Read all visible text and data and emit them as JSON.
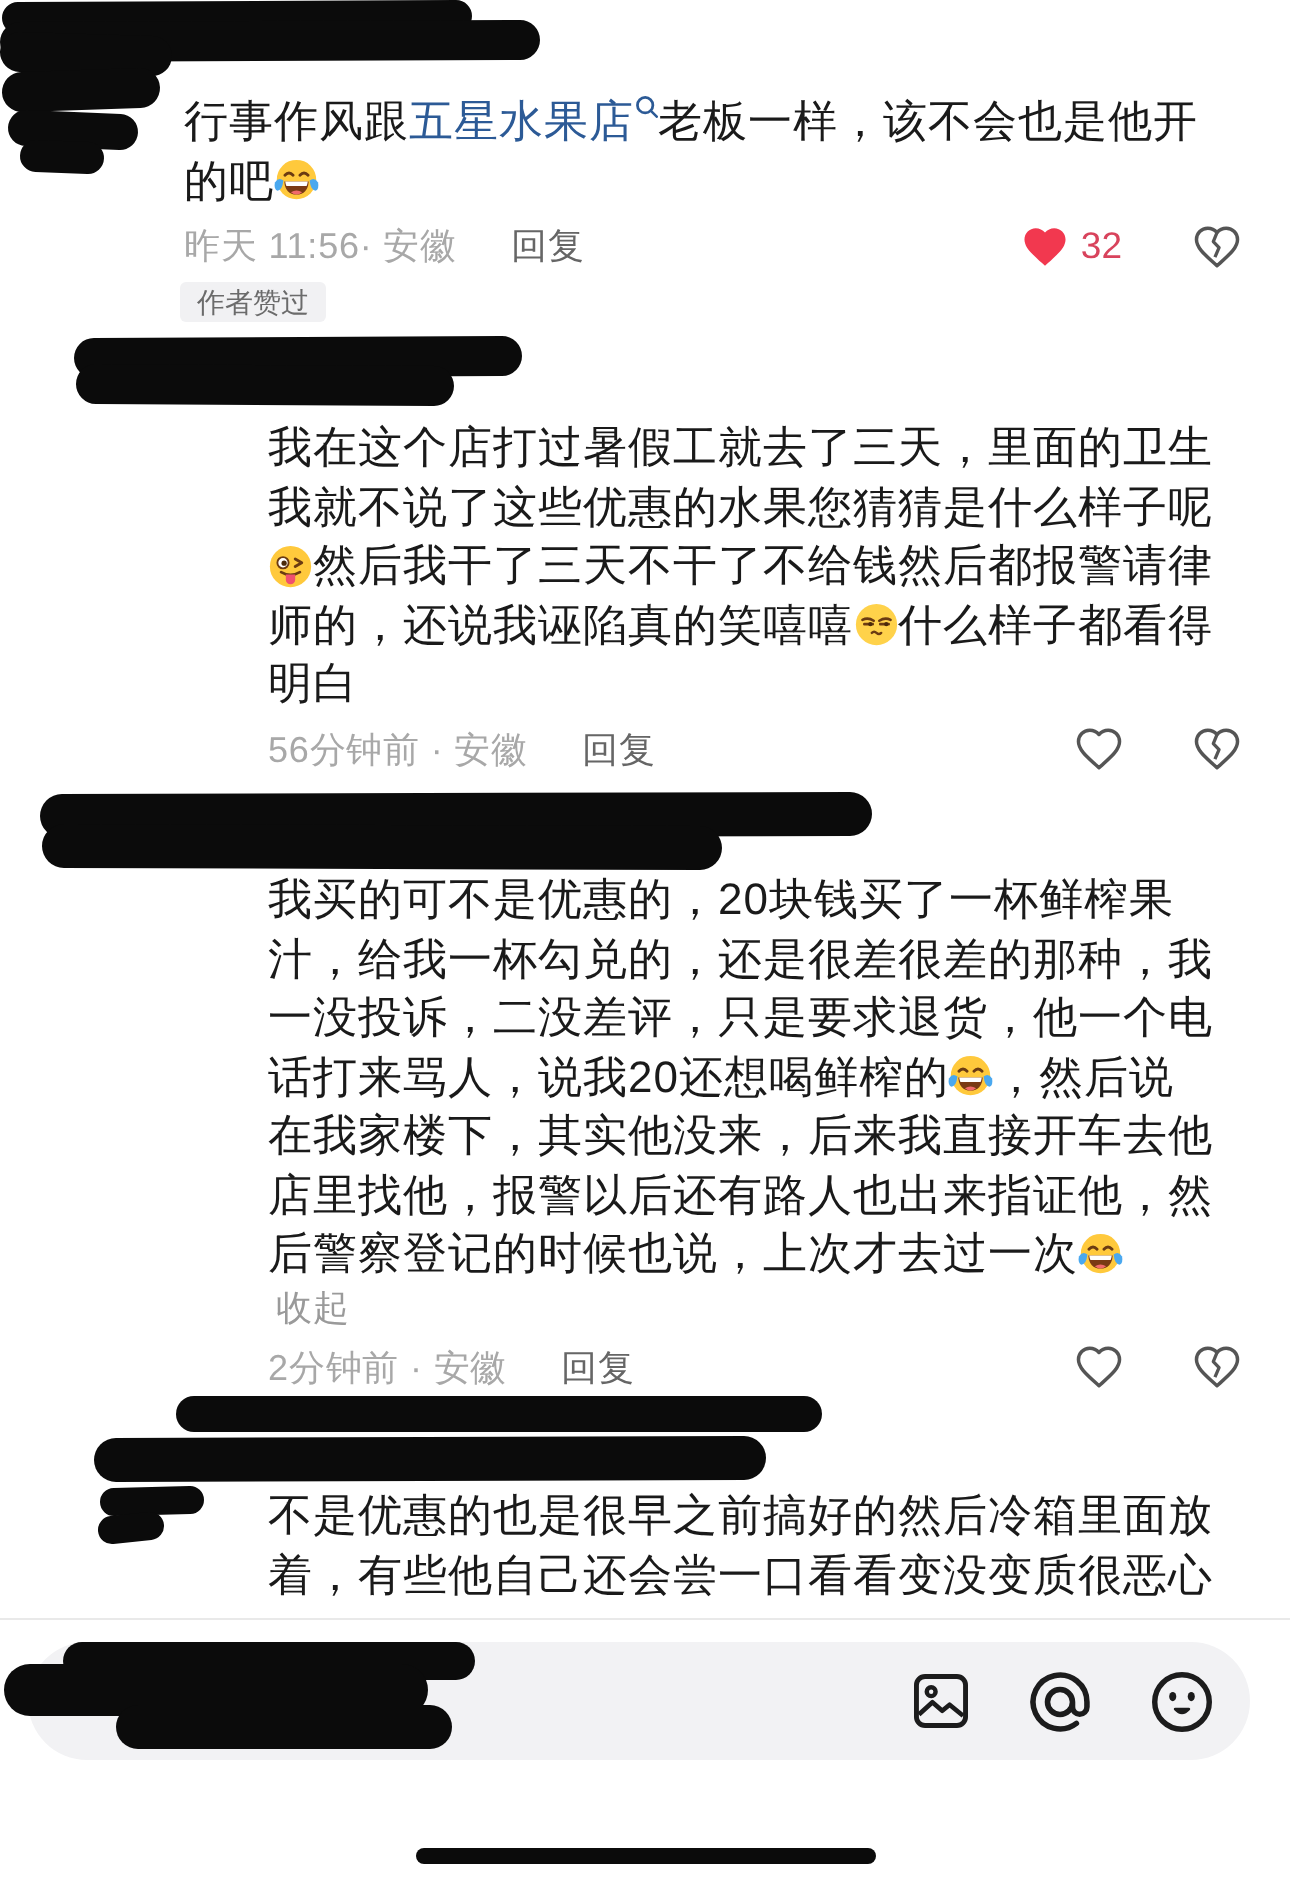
{
  "comments": [
    {
      "body": [
        {
          "kind": "text",
          "text": "行事作风跟"
        },
        {
          "kind": "link",
          "text": "五星水果店"
        },
        {
          "kind": "text",
          "text": "老板一样，该不会也是他开的吧"
        },
        {
          "kind": "laughing"
        }
      ],
      "meta": "昨天 11:56· 安徽",
      "reply_label": "回复",
      "liked": true,
      "likes": "32",
      "disliked": false,
      "tag": "作者赞过",
      "replies": [
        {
          "body": [
            {
              "kind": "text",
              "text": "我在这个店打过暑假工就去了三天，里面的卫生我就不说了这些优惠的水果您猜猜是什么样子呢"
            },
            {
              "kind": "winking"
            },
            {
              "kind": "text",
              "text": "然后我干了三天不干了不给钱然后都报警请律师的，还说我诬陷真的笑嘻嘻"
            },
            {
              "kind": "sideeye"
            },
            {
              "kind": "text",
              "text": "什么样子都看得明白"
            }
          ],
          "meta": "56分钟前 · 安徽",
          "reply_label": "回复",
          "liked": false,
          "disliked": false
        },
        {
          "body": [
            {
              "kind": "text",
              "text": "我买的可不是优惠的，20块钱买了一杯鲜榨果汁，给我一杯勾兑的，还是很差很差的那种，我一没投诉，二没差评，只是要求退货，他一个电话打来骂人，说我20还想喝鲜榨的"
            },
            {
              "kind": "laughing"
            },
            {
              "kind": "text",
              "text": "，然后说在我家楼下，其实他没来，后来我直接开车去他店里找他，报警以后还有路人也出来指证他，然后警察登记的时候也说，上次才去过一次"
            },
            {
              "kind": "laughing"
            }
          ],
          "collapse_label": "收起",
          "meta": "2分钟前 · 安徽",
          "reply_label": "回复",
          "liked": false,
          "disliked": false
        },
        {
          "body": [
            {
              "kind": "text",
              "text": "不是优惠的也是很早之前搞好的然后冷箱里面放着，有些他自己还会尝一口看看变没变质很恶心"
            }
          ]
        }
      ]
    }
  ]
}
